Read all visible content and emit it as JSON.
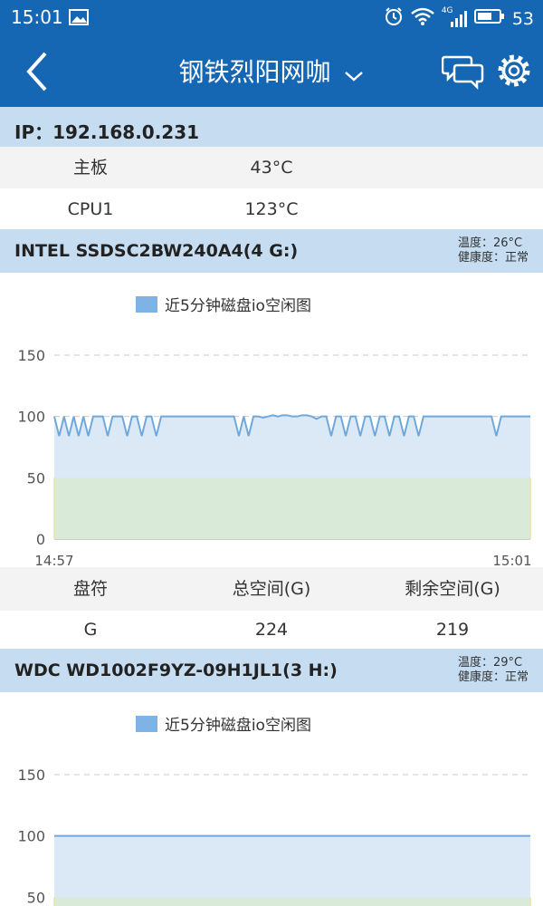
{
  "status": {
    "time": "15:01",
    "net": "4G",
    "battery": "53"
  },
  "appbar": {
    "title": "钢铁烈阳网咖"
  },
  "ip": {
    "label": "IP：192.168.0.231"
  },
  "temps": [
    {
      "name": "主板",
      "value": "43°C"
    },
    {
      "name": "CPU1",
      "value": "123°C"
    }
  ],
  "disks": [
    {
      "title": "INTEL SSDSC2BW240A4(4 G:)",
      "temp": "温度：26°C",
      "health": "健康度：正常",
      "legend": "近5分钟磁盘io空闲图",
      "x_start": "14:57",
      "x_end": "15:01",
      "table": {
        "headers": [
          "盘符",
          "总空间(G)",
          "剩余空间(G)"
        ],
        "row": [
          "G",
          "224",
          "219"
        ]
      }
    },
    {
      "title": "WDC WD1002F9YZ-09H1JL1(3 H:)",
      "temp": "温度：29°C",
      "health": "健康度：正常",
      "legend": "近5分钟磁盘io空闲图"
    }
  ],
  "colors": {
    "primary": "#1566b3",
    "section": "#c6ddf1",
    "line": "#6fa8dc",
    "fill": "#dbe8f5",
    "lowfill": "#d9ead8"
  },
  "chart_data": [
    {
      "type": "area",
      "legend": [
        "近5分钟磁盘io空闲图"
      ],
      "x_labels": [
        "14:57",
        "15:01"
      ],
      "ylim": [
        0,
        150
      ],
      "yticks": [
        0,
        50,
        100,
        150
      ],
      "threshold": 50,
      "values": [
        100,
        84,
        100,
        84,
        100,
        84,
        100,
        84,
        100,
        100,
        100,
        84,
        100,
        100,
        100,
        84,
        100,
        100,
        84,
        100,
        100,
        84,
        100,
        100,
        100,
        100,
        100,
        100,
        100,
        100,
        100,
        100,
        100,
        100,
        100,
        100,
        100,
        100,
        84,
        100,
        84,
        100,
        100,
        99,
        100,
        101,
        100,
        101,
        101,
        100,
        100,
        101,
        101,
        100,
        98,
        100,
        100,
        84,
        100,
        100,
        84,
        100,
        100,
        84,
        100,
        100,
        84,
        100,
        100,
        84,
        100,
        100,
        84,
        100,
        100,
        84,
        100,
        100,
        100,
        100,
        100,
        100,
        100,
        100,
        100,
        100,
        100,
        100,
        100,
        100,
        100,
        84,
        100,
        100,
        100,
        100,
        100,
        100,
        100
      ]
    },
    {
      "type": "area",
      "legend": [
        "近5分钟磁盘io空闲图"
      ],
      "ylim": [
        0,
        150
      ],
      "yticks": [
        50,
        100,
        150
      ],
      "threshold": 50,
      "values": [
        100,
        100
      ]
    }
  ]
}
